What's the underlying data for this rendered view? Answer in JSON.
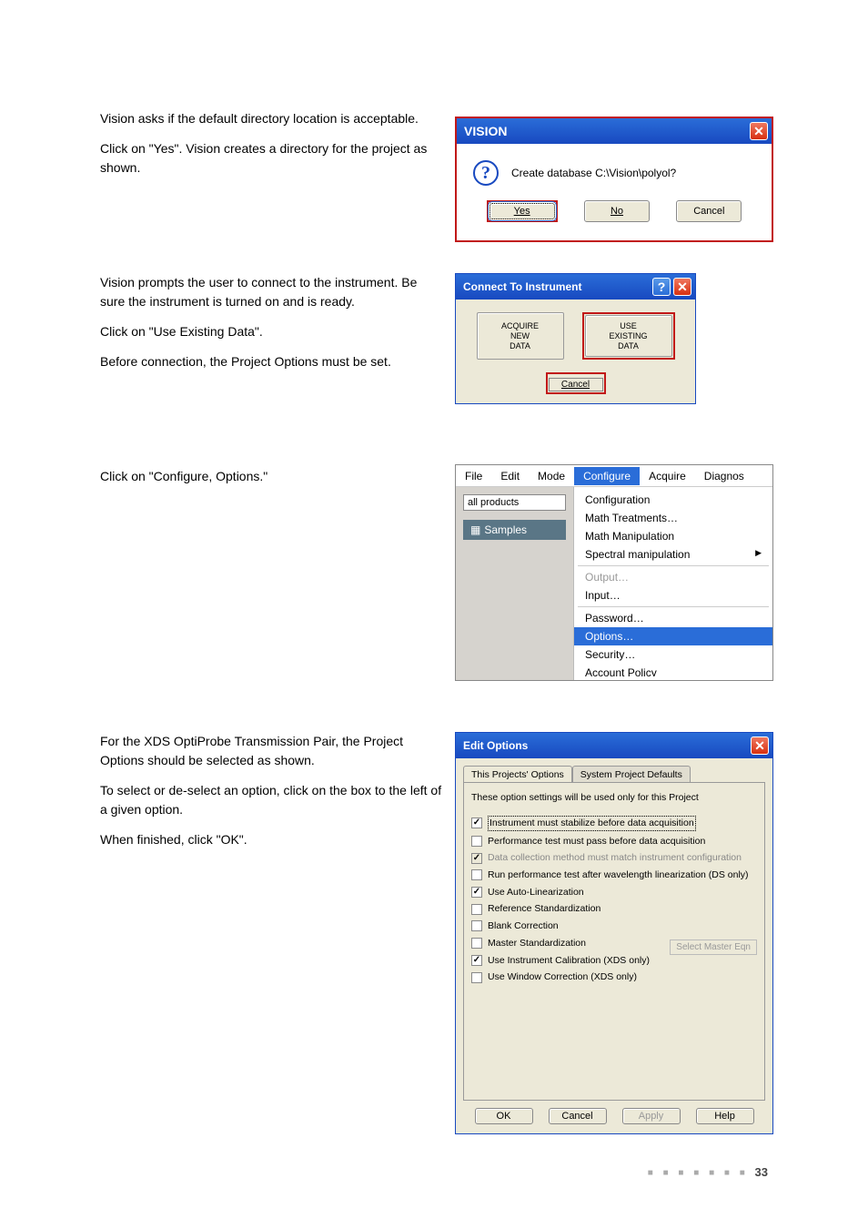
{
  "page_number": "33",
  "left_text": {
    "p1": "Vision asks if the default directory location is acceptable.",
    "p2": "Click on \"Yes\". Vision creates a directory for the project as shown.",
    "p3": "Vision prompts the user to connect to the instrument. Be sure the instrument is turned on and is ready.",
    "p4": "Click on \"Use Existing Data\".",
    "p5": "Before connection, the Project Options must be set.",
    "p6": "Click on \"Configure, Options.\"",
    "p7": "For the XDS OptiProbe Transmission Pair, the Project Options should be selected as shown.",
    "p8": "To select or de-select an option, click on the box to the left of a given option.",
    "p9": "When finished, click \"OK\"."
  },
  "dlg_vision": {
    "title": "VISION",
    "message": "Create database C:\\Vision\\polyol?",
    "yes": "Yes",
    "no": "No",
    "cancel": "Cancel"
  },
  "dlg_connect": {
    "title": "Connect To Instrument",
    "acquire": "ACQUIRE\nNEW\nDATA",
    "use_existing": "USE\nEXISTING\nDATA",
    "cancel": "Cancel"
  },
  "dlg_menu": {
    "menubar": {
      "file": "File",
      "edit": "Edit",
      "mode": "Mode",
      "configure": "Configure",
      "acquire": "Acquire",
      "diagnos": "Diagnos"
    },
    "combo": "all products",
    "samples": "Samples",
    "dropdown": {
      "configuration": "Configuration",
      "math_treatments": "Math Treatments…",
      "math_manipulation": "Math Manipulation",
      "spectral_manipulation": "Spectral manipulation",
      "output": "Output…",
      "input": "Input…",
      "password": "Password…",
      "options": "Options…",
      "security": "Security…",
      "account_policy": "Account Policy"
    }
  },
  "dlg_options": {
    "title": "Edit Options",
    "tabs": {
      "this": "This Projects' Options",
      "system": "System Project Defaults"
    },
    "note": "These option settings will be used only for this Project",
    "opts": {
      "o1": {
        "label": "Instrument must stabilize before data acquisition",
        "checked": true,
        "disabled": false,
        "focus": true
      },
      "o2": {
        "label": "Performance test must pass before data acquisition",
        "checked": false,
        "disabled": false
      },
      "o3": {
        "label": "Data collection method must match instrument configuration",
        "checked": true,
        "disabled": true
      },
      "o4": {
        "label": "Run performance test after wavelength linearization (DS only)",
        "checked": false,
        "disabled": false
      },
      "o5": {
        "label": "Use Auto-Linearization",
        "checked": true,
        "disabled": false
      },
      "o6": {
        "label": "Reference Standardization",
        "checked": false,
        "disabled": false
      },
      "o7": {
        "label": "Blank Correction",
        "checked": false,
        "disabled": false
      },
      "o8": {
        "label": "Master Standardization",
        "checked": false,
        "disabled": false
      },
      "o9": {
        "label": "Use Instrument Calibration (XDS only)",
        "checked": true,
        "disabled": false
      },
      "o10": {
        "label": "Use Window Correction (XDS only)",
        "checked": false,
        "disabled": false
      }
    },
    "select_master": "Select Master Eqn",
    "buttons": {
      "ok": "OK",
      "cancel": "Cancel",
      "apply": "Apply",
      "help": "Help"
    }
  }
}
